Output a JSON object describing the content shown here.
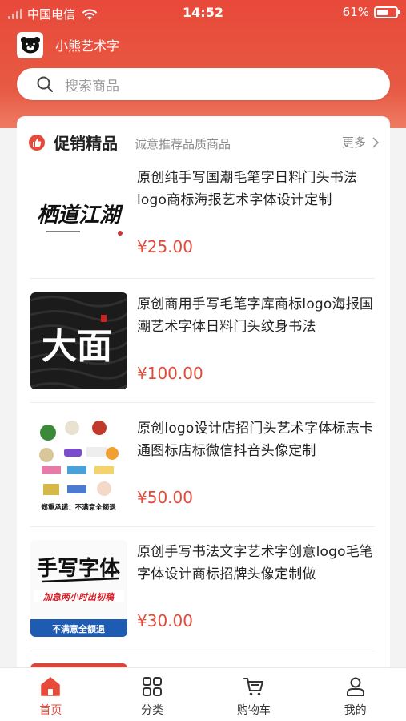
{
  "status_bar": {
    "carrier": "中国电信",
    "time": "14:52",
    "battery": "61%"
  },
  "app": {
    "name": "小熊艺术字"
  },
  "search": {
    "placeholder": "搜索商品"
  },
  "section": {
    "title": "促销精品",
    "subtitle": "诚意推荐品质商品",
    "more": "更多"
  },
  "products": [
    {
      "title": "原创纯手写国潮毛笔字日料门头书法logo商标海报艺术字体设计定制",
      "price": "¥25.00",
      "thumb_text": "栖道江湖"
    },
    {
      "title": "原创商用手写毛笔字库商标logo海报国潮艺术字体日料门头纹身书法",
      "price": "¥100.00",
      "thumb_text": "大面"
    },
    {
      "title": "原创logo设计店招门头艺术字体标志卡通图标店标微信抖音头像定制",
      "price": "¥50.00",
      "thumb_text": "郑重承诺：不满意全额退"
    },
    {
      "title": "原创手写书法文字艺术字创意logo毛笔字体设计商标招牌头像定制做",
      "price": "¥30.00",
      "thumb_text": "手写字体",
      "badge1": "加急两小时出初稿",
      "badge2": "不满意全额退"
    }
  ],
  "tabs": [
    {
      "label": "首页",
      "icon": "home-icon",
      "active": true
    },
    {
      "label": "分类",
      "icon": "grid-icon",
      "active": false
    },
    {
      "label": "购物车",
      "icon": "cart-icon",
      "active": false
    },
    {
      "label": "我的",
      "icon": "user-icon",
      "active": false
    }
  ],
  "colors": {
    "brand_red": "#e7493a",
    "price_red": "#e04b3a"
  }
}
